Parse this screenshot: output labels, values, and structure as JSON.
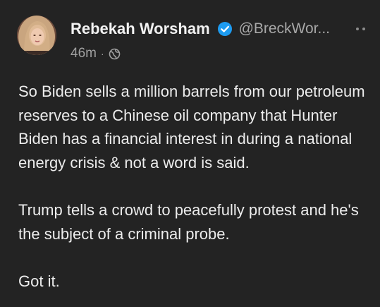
{
  "post": {
    "author": {
      "display_name": "Rebekah Worsham",
      "handle": "@BreckWor...",
      "verified": true,
      "avatar": "profile-photo"
    },
    "timestamp": "46m",
    "separator": "·",
    "visibility_icon": "globe-icon",
    "more_icon": "more-dots-icon",
    "paragraphs": [
      "So Biden sells a million barrels from our petroleum reserves to a Chinese oil company that Hunter Biden has a financial interest in during a national energy crisis & not a word is said.",
      "Trump tells a crowd to peacefully protest and he's the subject of a criminal probe.",
      "Got it."
    ]
  },
  "colors": {
    "background": "#232323",
    "text": "#ececec",
    "muted": "#a0a0a0",
    "verified_badge": "#1d9bf0"
  }
}
